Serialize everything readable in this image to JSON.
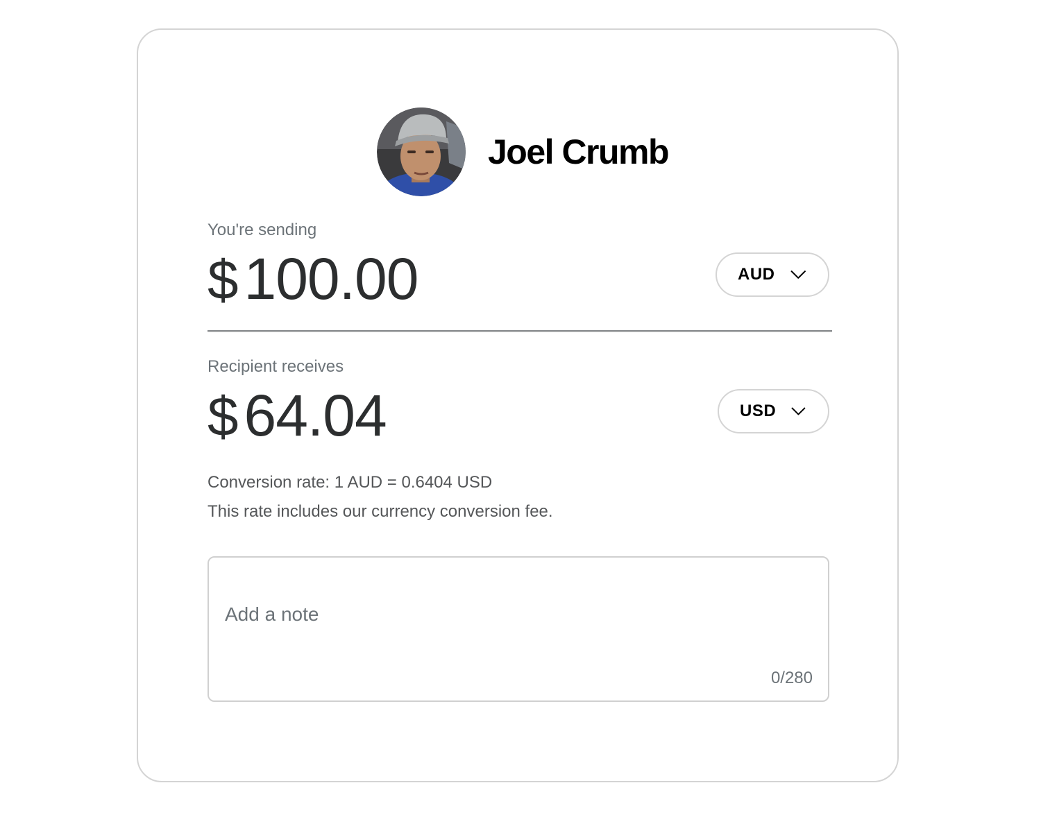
{
  "recipient": {
    "name": "Joel Crumb",
    "avatar_icon": "user-photo-avatar"
  },
  "sending": {
    "label": "You're sending",
    "currency_symbol": "$",
    "amount": "100.00",
    "currency": "AUD"
  },
  "receiving": {
    "label": "Recipient receives",
    "currency_symbol": "$",
    "amount": "64.04",
    "currency": "USD"
  },
  "conversion": {
    "rate_text": "Conversion rate: 1 AUD = 0.6404 USD",
    "fee_text": "This rate includes our currency conversion fee."
  },
  "note": {
    "placeholder": "Add a note",
    "counter": "0/280"
  },
  "colors": {
    "text_primary": "#2c2e2f",
    "text_secondary": "#6c7378",
    "border": "#d4d4d4"
  }
}
